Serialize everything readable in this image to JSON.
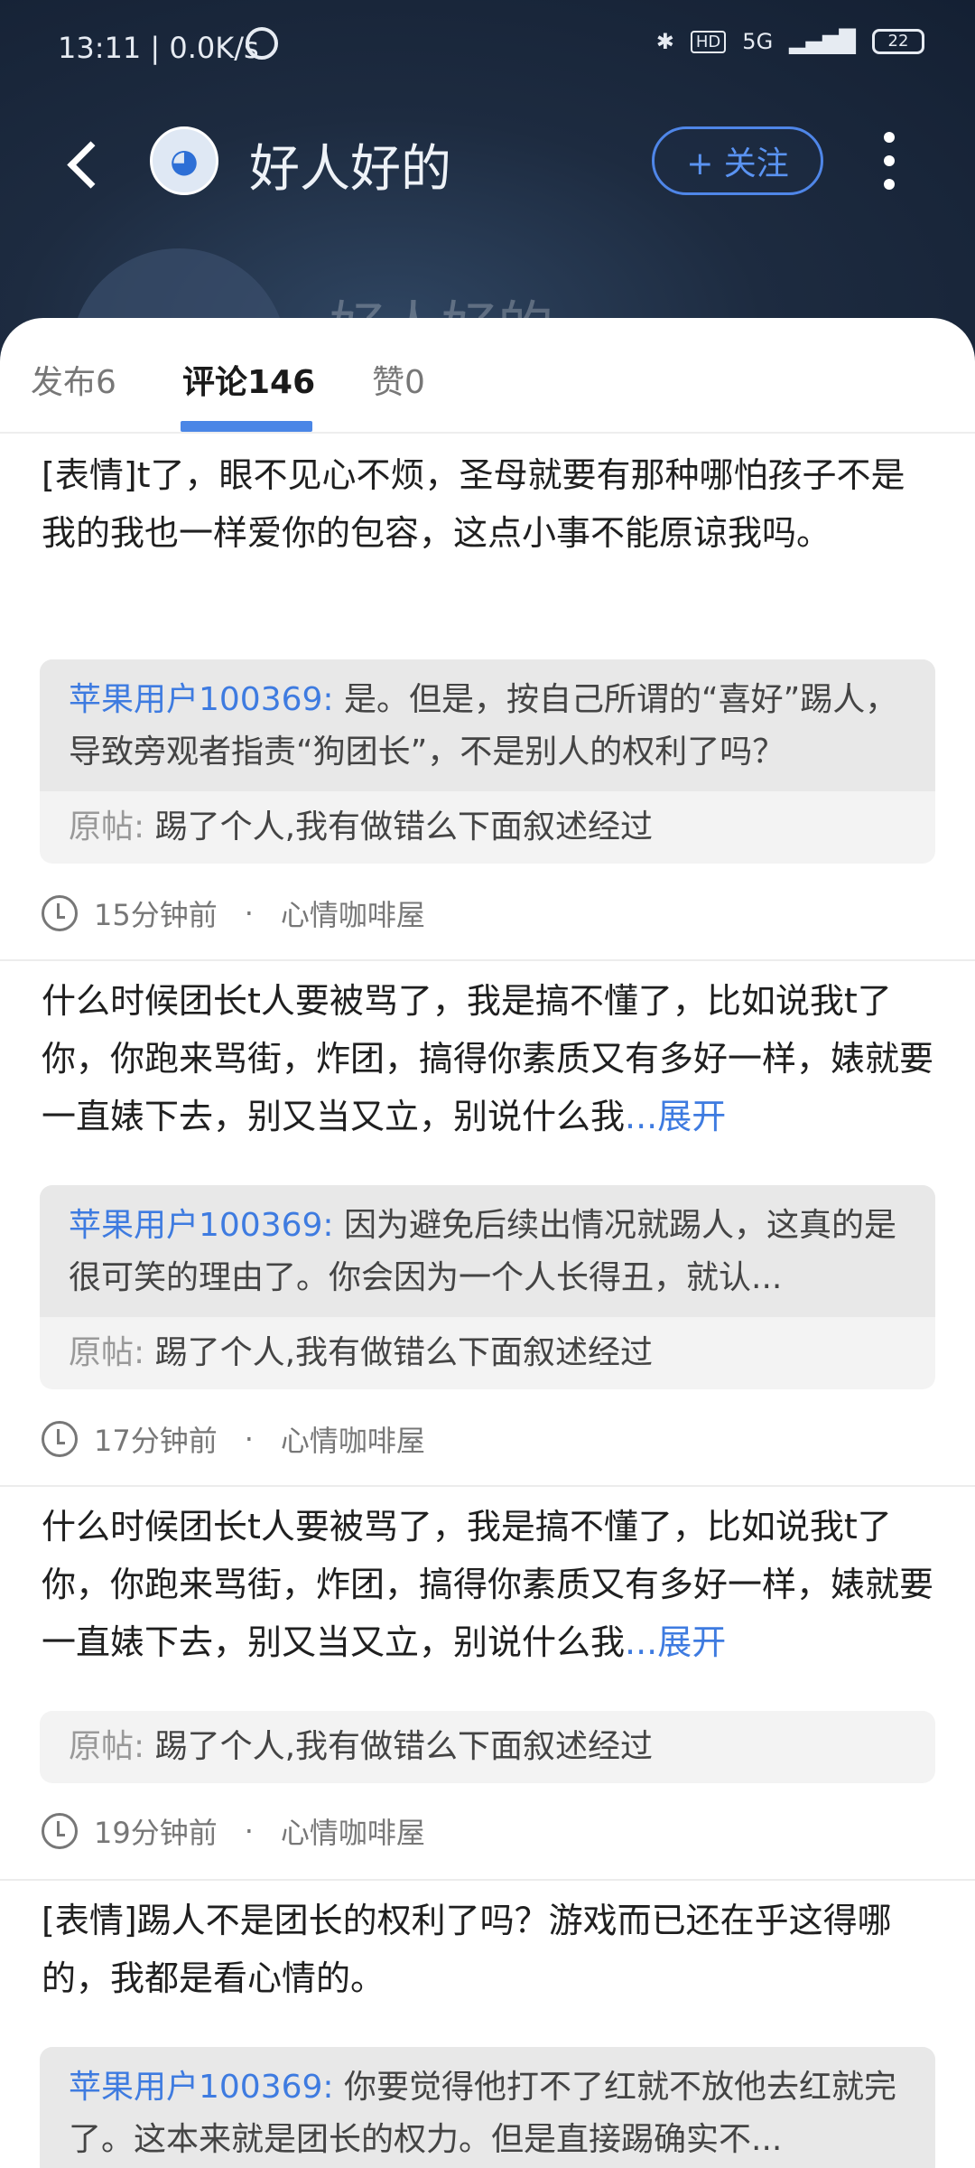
{
  "status_bar": {
    "time": "13:11 | 0.0K/s",
    "network": "5G",
    "hd": "HD",
    "battery": "22"
  },
  "header": {
    "title": "好人好的",
    "follow_label": "+ 关注",
    "ghost_name": "好人好的"
  },
  "tabs": [
    {
      "label": "发布6"
    },
    {
      "label": "评论146"
    },
    {
      "label": "赞0"
    }
  ],
  "comments": [
    {
      "text": "[表情]t了，眼不见心不烦，圣母就要有那种哪怕孩子不是我的我也一样爱你的包容，这点小事不能原谅我吗。",
      "expand": "",
      "reply_user": "苹果用户100369:",
      "reply_text": " 是。但是，按自己所谓的“喜好”踢人，导致旁观者指责“狗团长”，不是别人的权利了吗？",
      "origin_label": "原帖:",
      "origin_text": " 踢了个人,我有做错么下面叙述经过",
      "time": "15分钟前",
      "sep": "·",
      "group": "心情咖啡屋"
    },
    {
      "text": "什么时候团长t人要被骂了，我是搞不懂了，比如说我t了你，你跑来骂街，炸团，搞得你素质又有多好一样，婊就要一直婊下去，别又当又立，别说什么我",
      "expand": "...展开",
      "reply_user": "苹果用户100369:",
      "reply_text": " 因为避免后续出情况就踢人，这真的是很可笑的理由了。你会因为一个人长得丑，就认...",
      "origin_label": "原帖:",
      "origin_text": " 踢了个人,我有做错么下面叙述经过",
      "time": "17分钟前",
      "sep": "·",
      "group": "心情咖啡屋"
    },
    {
      "text": "什么时候团长t人要被骂了，我是搞不懂了，比如说我t了你，你跑来骂街，炸团，搞得你素质又有多好一样，婊就要一直婊下去，别又当又立，别说什么我",
      "expand": "...展开",
      "origin_label": "原帖:",
      "origin_text": " 踢了个人,我有做错么下面叙述经过",
      "time": "19分钟前",
      "sep": "·",
      "group": "心情咖啡屋"
    },
    {
      "text": "[表情]踢人不是团长的权利了吗？游戏而已还在乎这得哪的，我都是看心情的。",
      "expand": "",
      "reply_user": "苹果用户100369:",
      "reply_text": " 你要觉得他打不了红就不放他去红就完了。这本来就是团长的权力。但是直接踢确实不..."
    }
  ]
}
